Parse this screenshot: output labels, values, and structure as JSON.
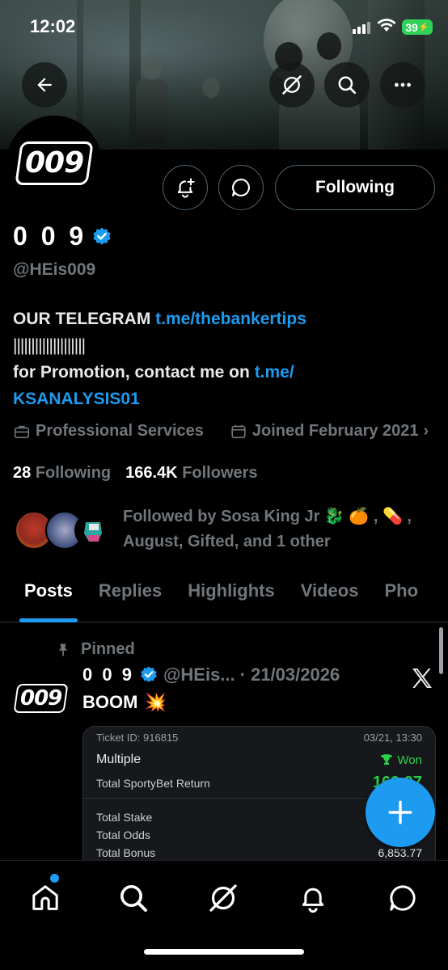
{
  "status_bar": {
    "time": "12:02",
    "battery": "39"
  },
  "profile": {
    "display_name": "0 0 9",
    "handle": "@HEis009",
    "avatar_text": "009",
    "bio_line1_text": "OUR TELEGRAM ",
    "bio_line1_link": "t.me/thebankertips",
    "bio_line2": "||||||||||||||||||||",
    "bio_line3_text": "for Promotion, contact me on ",
    "bio_line3_link": "t.me/",
    "bio_line4_link": "KSANALYSIS01",
    "category": "Professional Services",
    "joined": "Joined February 2021",
    "following_count": "28",
    "following_label": "Following",
    "followers_count": "166.4K",
    "followers_label": "Followers",
    "followed_by_line1": "Followed by Sosa King Jr 🐉 🍊 , 💊 ,",
    "followed_by_line2": "August, Gifted, and 1 other"
  },
  "actions": {
    "following_label": "Following"
  },
  "tabs": [
    {
      "label": "Posts",
      "active": true
    },
    {
      "label": "Replies"
    },
    {
      "label": "Highlights"
    },
    {
      "label": "Videos"
    },
    {
      "label": "Pho"
    }
  ],
  "pinned_post": {
    "pinned_label": "Pinned",
    "author_name": "0 0 9",
    "author_handle": "@HEis...",
    "date": "· 21/03/2026",
    "text": "BOOM",
    "emoji": "💥",
    "ticket": {
      "ticket_id": "Ticket ID: 916815",
      "datetime": "03/21, 13:30",
      "type": "Multiple",
      "status": "Won",
      "return_label": "Total SportyBet Return",
      "return_value": "169,97",
      "stake_label": "Total Stake",
      "odds_label": "Total Odds",
      "bonus_label": "Total Bonus",
      "bonus_value": "6,853.77"
    }
  },
  "colors": {
    "accent": "#1d9bf0",
    "muted": "#71767b",
    "won": "#2bd34a"
  },
  "icons": [
    "back-arrow-icon",
    "grok-icon",
    "search-icon",
    "more-icon",
    "bell-plus-icon",
    "message-icon",
    "verified-badge-icon",
    "briefcase-icon",
    "calendar-icon",
    "pin-icon",
    "x-logo-icon",
    "plus-icon",
    "home-icon",
    "bell-icon",
    "trophy-icon"
  ]
}
